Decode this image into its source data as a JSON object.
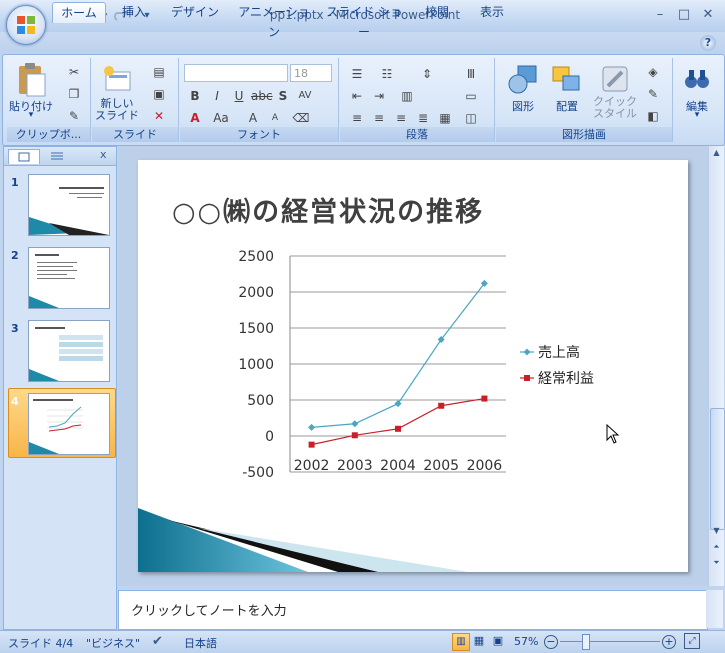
{
  "window": {
    "title": "pp1.pptx - Microsoft PowerPoint",
    "minimize": "–",
    "maximize": "□",
    "close": "✕"
  },
  "qat": {
    "save_icon": "save-icon",
    "undo_icon": "undo-icon",
    "redo_icon": "redo-icon",
    "more": "▾"
  },
  "tabs": [
    "ホーム",
    "挿入",
    "デザイン",
    "アニメーション",
    "スライド ショー",
    "校閲",
    "表示"
  ],
  "ribbon": {
    "paste_label": "貼り付け",
    "new_slide_label": "新しい\nスライド",
    "font_size": "18",
    "shape_label": "図形",
    "arrange_label": "配置",
    "quick_style_label": "クイック\nスタイル",
    "edit_label": "編集",
    "groups": [
      "クリップボ...",
      "スライド",
      "フォント",
      "段落",
      "図形描画"
    ]
  },
  "slides_panel": {
    "numbers": [
      "1",
      "2",
      "3",
      "4"
    ],
    "selected_index": 4
  },
  "slide": {
    "title": "○○㈱の経営状況の推移"
  },
  "chart_data": {
    "type": "line",
    "categories": [
      "2002",
      "2003",
      "2004",
      "2005",
      "2006"
    ],
    "series": [
      {
        "name": "売上高",
        "values": [
          120,
          170,
          450,
          1340,
          2120
        ],
        "color": "#4aa6c4"
      },
      {
        "name": "経常利益",
        "values": [
          -120,
          10,
          100,
          420,
          520
        ],
        "color": "#c8202a"
      }
    ],
    "yticks": [
      "2500",
      "2000",
      "1500",
      "1000",
      "500",
      "0",
      "-500"
    ],
    "ylim": [
      -500,
      2500
    ],
    "grid": true,
    "legend": "right"
  },
  "notes": {
    "placeholder": "クリックしてノートを入力"
  },
  "status": {
    "slide": "スライド 4/4",
    "theme": "\"ビジネス\"",
    "language": "日本語",
    "zoom": "57%"
  }
}
